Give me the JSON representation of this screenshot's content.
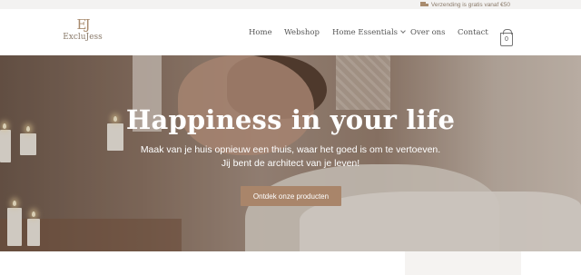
{
  "topbar": {
    "shipping_icon": "truck-icon",
    "shipping_text": "Verzending is gratis vanaf €50"
  },
  "header": {
    "logo_monogram": "EJ",
    "logo_word": "ExcluJess",
    "nav": [
      {
        "label": "Home"
      },
      {
        "label": "Webshop"
      },
      {
        "label": "Home Essentials",
        "has_dropdown": true
      },
      {
        "label": "Over ons"
      },
      {
        "label": "Contact"
      }
    ],
    "cart_count": "0",
    "cart_icon": "shopping-bag-icon"
  },
  "hero": {
    "title": "Happiness in your life",
    "subtitle_line1": "Maak van je huis opnieuw een thuis, waar het goed is om te vertoeven.",
    "subtitle_line2": "Jij bent de architect van je leven!",
    "cta_label": "Ontdek onze producten"
  },
  "colors": {
    "accent": "#a9856a",
    "topbar_bg": "#f3f2f1",
    "text": "#555555"
  }
}
